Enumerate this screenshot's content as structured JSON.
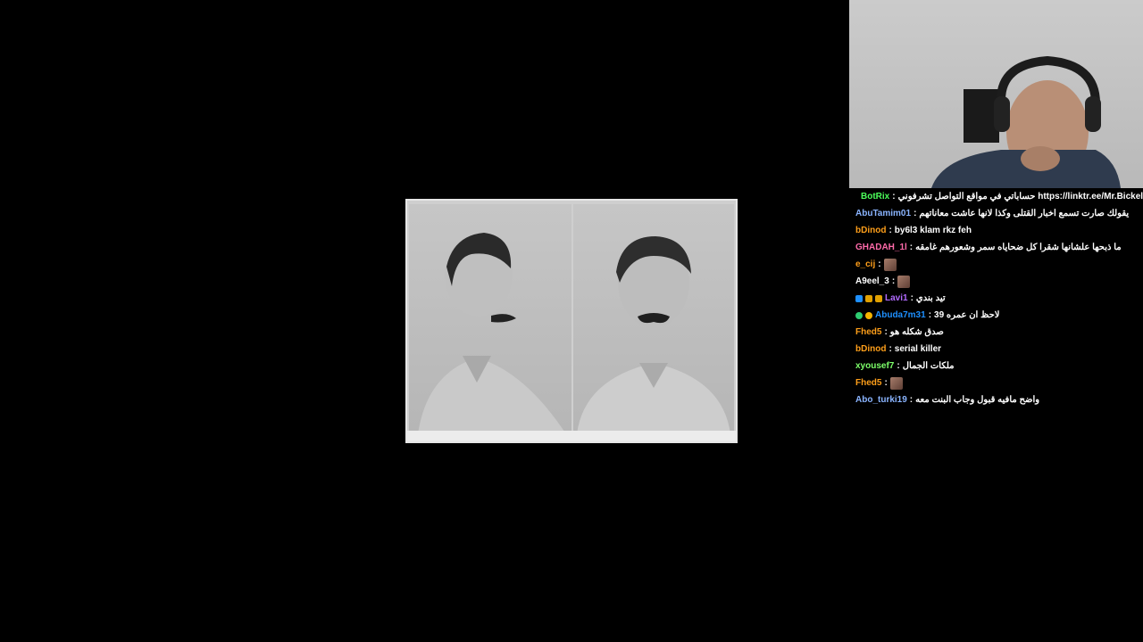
{
  "colors": {
    "BotRix": "#4cff5b",
    "AbuTamim01": "#8ab4ff",
    "bDinod": "#ff9f1a",
    "GHADAH_1l": "#ff6aa9",
    "e_cij": "#ff9f1a",
    "A9eel_3": "#ffffff",
    "Lavi1": "#b26bff",
    "Abuda7m31": "#1e90ff",
    "Fhed5": "#ff9f1a",
    "xyousef7": "#7dff6a",
    "Abo_turki19": "#8ab4ff"
  },
  "chat": [
    {
      "user": "BotRix",
      "sep": ":",
      "msg": "حساباتي في مواقع التواصل تشرفوني https://linktr.ee/Mr.Bickel",
      "badges": [
        "mod",
        "ok"
      ]
    },
    {
      "user": "AbuTamim01",
      "sep": ":",
      "msg": "يقولك صارت تسمع اخبار القتلى وكذا لانها عاشت معاناتهم",
      "badges": []
    },
    {
      "user": "bDinod",
      "sep": ":",
      "msg": "by6l3 klam rkz feh",
      "badges": []
    },
    {
      "user": "GHADAH_1l",
      "sep": ":",
      "msg": "ما ذبحها علشانها شقرا كل ضحاياه سمر وشعورهم غامقه",
      "badges": []
    },
    {
      "user": "e_cij",
      "sep": ":",
      "msg": "",
      "badges": [],
      "emote": true
    },
    {
      "user": "A9eel_3",
      "sep": ":",
      "msg": "",
      "badges": [],
      "emote": true
    },
    {
      "user": "Lavi1",
      "sep": ":",
      "msg": "تيد بندي",
      "badges": [
        "mod",
        "gem",
        "crown"
      ]
    },
    {
      "user": "Abuda7m31",
      "sep": ":",
      "msg": "لاحظ ان عمره 39",
      "badges": [
        "ok",
        "gold"
      ]
    },
    {
      "user": "Fhed5",
      "sep": ":",
      "msg": "صدق شكله هو",
      "badges": []
    },
    {
      "user": "bDinod",
      "sep": ":",
      "msg": "serial killer",
      "badges": []
    },
    {
      "user": "xyousef7",
      "sep": ":",
      "msg": "ملكات الجمال",
      "badges": []
    },
    {
      "user": "Fhed5",
      "sep": ":",
      "msg": "",
      "badges": [],
      "emote": true
    },
    {
      "user": "Abo_turki19",
      "sep": ":",
      "msg": "واضح مافيه قبول وجاب البنت معه",
      "badges": []
    }
  ]
}
